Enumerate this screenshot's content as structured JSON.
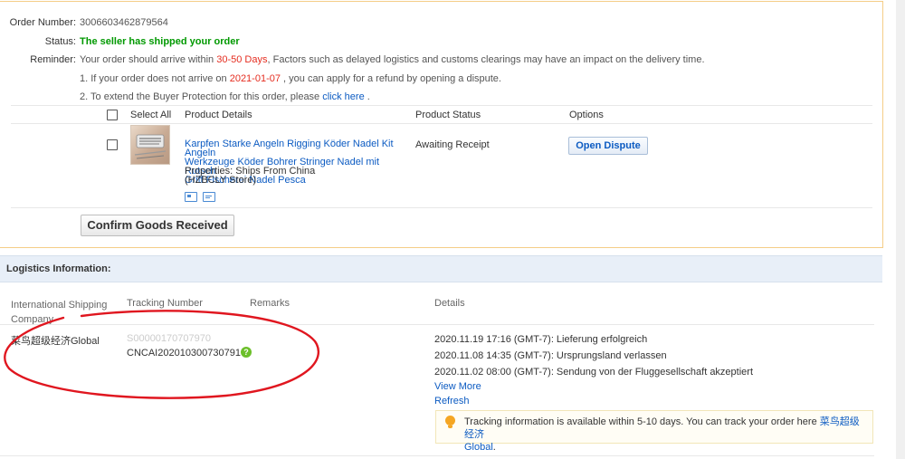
{
  "order": {
    "number_label": "Order Number:",
    "number": "3006603462879564",
    "status_label": "Status:",
    "status": "The seller has shipped your order",
    "reminder_label": "Reminder:",
    "reminder_prefix": "Your order should arrive within ",
    "reminder_days": "30-50 Days",
    "reminder_suffix": ", Factors such as delayed logistics and customs clearings may have an impact on the delivery time.",
    "note1_prefix": "1. If your order does not arrive on ",
    "note1_date": "2021-01-07",
    "note1_suffix": " , you can apply for a refund by opening a dispute.",
    "note2_prefix": "2. To extend the Buyer Protection for this order, please ",
    "note2_link": "click here",
    "note2_suffix": " ."
  },
  "products": {
    "header": {
      "select_all": "Select All",
      "details": "Product Details",
      "status": "Product Status",
      "options": "Options"
    },
    "items": [
      {
        "title_line1": "Karpfen Starke Angeln Rigging Köder Nadel Kit Angeln",
        "title_line2": "Werkzeuge Köder Bohrer Stringer Nadel mit Rutsch",
        "title_line3": "Griff Fischerei Nadel Pesca",
        "properties": "Properties: Ships From China",
        "store": "(HZBCLY Store)",
        "status": "Awaiting Receipt",
        "action": "Open Dispute",
        "icons": [
          "snapshot-icon",
          "feedback-icon"
        ]
      }
    ]
  },
  "confirm_button": "Confirm Goods Received",
  "logistics": {
    "title": "Logistics Information:",
    "columns": {
      "company_line1": "International Shipping",
      "company_line2": "Company",
      "tracking": "Tracking Number",
      "remarks": "Remarks",
      "details": "Details"
    },
    "company": "菜鸟超级经济Global",
    "tracking_old": "S00000170707970",
    "tracking_main": "CNCAI202010300730791 7",
    "events": [
      "2020.11.19 17:16 (GMT-7): Lieferung erfolgreich",
      "2020.11.08 14:35 (GMT-7): Ursprungsland verlassen",
      "2020.11.02 08:00 (GMT-7): Sendung von der Fluggesellschaft akzeptiert"
    ],
    "view_more": "View More",
    "refresh": "Refresh",
    "tip_text": "Tracking information is available within 5-10 days. You can track your order here ",
    "tip_link_line1": "菜鸟超级经济",
    "tip_link_line2": "Global",
    "tip_end": "."
  },
  "colors": {
    "accent_link": "#0c5bc2",
    "status_green": "#009900",
    "highlight_red": "#e52d20",
    "panel_border": "#f5cd87",
    "annotation_red": "#e0161f"
  }
}
